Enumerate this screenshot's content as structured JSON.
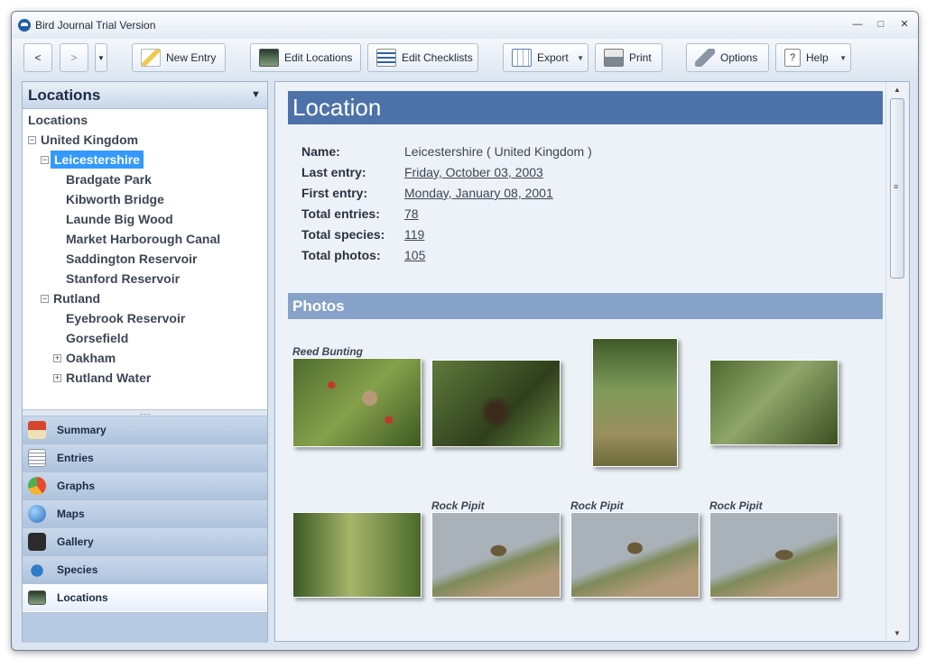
{
  "window": {
    "title": "Bird Journal Trial Version"
  },
  "toolbar": {
    "back_label": "<",
    "forward_label": ">",
    "new_entry": "New Entry",
    "edit_locations": "Edit Locations",
    "edit_checklists": "Edit Checklists",
    "export": "Export",
    "print": "Print",
    "options": "Options",
    "help": "Help"
  },
  "left_panel": {
    "title": "Locations",
    "tree": {
      "root": "Locations",
      "country": "United Kingdom",
      "county1": "Leicestershire",
      "county1_sites": [
        "Bradgate Park",
        "Kibworth Bridge",
        "Launde Big Wood",
        "Market Harborough Canal",
        "Saddington Reservoir",
        "Stanford Reservoir"
      ],
      "county2": "Rutland",
      "county2_sites": [
        "Eyebrook Reservoir",
        "Gorsefield"
      ],
      "county2_groups": [
        "Oakham",
        "Rutland Water"
      ]
    },
    "nav": [
      "Summary",
      "Entries",
      "Graphs",
      "Maps",
      "Gallery",
      "Species",
      "Locations"
    ],
    "active_nav": "Locations"
  },
  "content": {
    "heading": "Location",
    "fields": {
      "name_label": "Name:",
      "name_value": "Leicestershire ( United Kingdom )",
      "last_entry_label": "Last entry:",
      "last_entry_value": "Friday, October 03, 2003",
      "first_entry_label": "First entry:",
      "first_entry_value": "Monday, January 08, 2001",
      "total_entries_label": "Total entries:",
      "total_entries_value": "78",
      "total_species_label": "Total species:",
      "total_species_value": "119",
      "total_photos_label": "Total photos:",
      "total_photos_value": "105"
    },
    "photos_heading": "Photos",
    "photo_captions": [
      "Reed Bunting",
      "Rock Pipit",
      "Rock Pipit",
      "Rock Pipit"
    ]
  }
}
